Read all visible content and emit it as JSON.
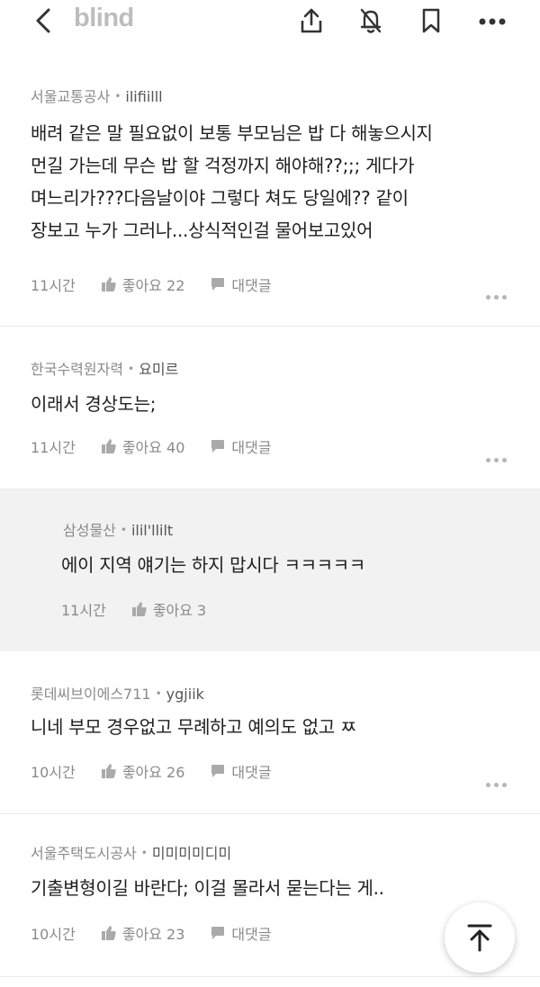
{
  "header": {
    "logo": "blind",
    "icons": [
      "back-arrow-icon",
      "share-icon",
      "notification-off-icon",
      "bookmark-icon",
      "more-icon"
    ]
  },
  "comments": [
    {
      "company": "서울교통공사",
      "nick": "ilifiilll",
      "lines": [
        "배려 같은 말 필요없이 보통 부모님은 밥 다 해놓으시지",
        "먼길 가는데 무슨 밥 할 걱정까지 해야해??;;; 게다가",
        "며느리가???다음날이야 그렇다 쳐도 당일에?? 같이",
        "장보고 누가 그러나...상식적인걸 물어보고있어"
      ],
      "time": "11시간",
      "likes": "좋아요 22",
      "reply": "대댓글"
    },
    {
      "company": "한국수력원자력",
      "nick": "요미르",
      "lines": [
        "이래서 경상도는;"
      ],
      "time": "11시간",
      "likes": "좋아요 40",
      "reply": "대댓글"
    },
    {
      "company": "삼성물산",
      "nick": "ilil'llilt",
      "lines": [
        "에이 지역 얘기는 하지 맙시다 ㅋㅋㅋㅋㅋ"
      ],
      "time": "11시간",
      "likes": "좋아요 3"
    },
    {
      "company": "롯데씨브이에스711",
      "nick": "ygjiik",
      "lines": [
        "니네 부모 경우없고 무례하고 예의도 없고 ㅉ"
      ],
      "time": "10시간",
      "likes": "좋아요 26",
      "reply": "대댓글"
    },
    {
      "company": "서울주택도시공사",
      "nick": "미미미미디미",
      "lines": [
        "기출변형이길 바란다; 이걸 몰라서 묻는다는 게.."
      ],
      "time": "10시간",
      "likes": "좋아요 23",
      "reply": "대댓글"
    }
  ],
  "colors": {
    "accent": "#222222",
    "muted": "#888888",
    "reply_bg": "#f2f2f2"
  }
}
